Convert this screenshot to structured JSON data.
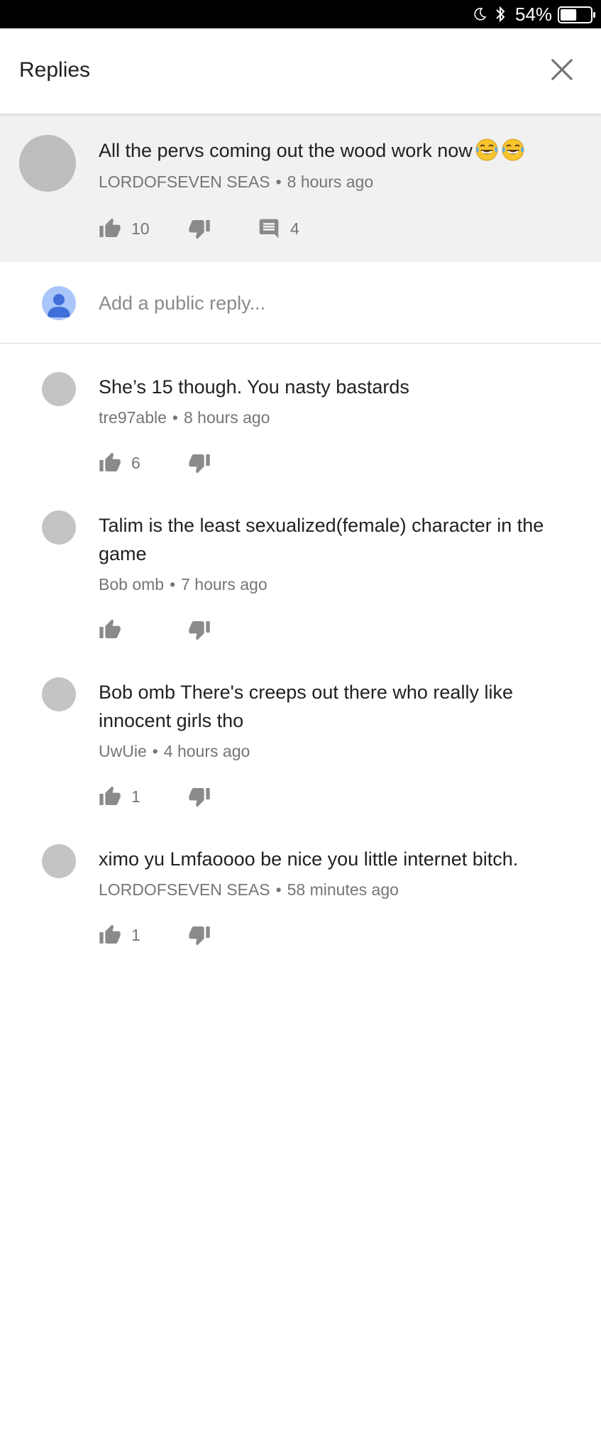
{
  "status_bar": {
    "battery_percent": "54%",
    "battery_level": 0.54
  },
  "header": {
    "title": "Replies"
  },
  "parent_comment": {
    "text": "All the pervs coming out the wood work now",
    "author": "LORDOFSEVEN SEAS",
    "time": "8 hours ago",
    "likes": "10",
    "replies": "4",
    "emojis": [
      "face-with-tears-of-joy-icon",
      "face-with-tears-of-joy-icon"
    ]
  },
  "composer": {
    "placeholder": "Add a public reply..."
  },
  "replies": [
    {
      "text": "She’s 15 though. You nasty bastards",
      "author": "tre97able",
      "time": "8 hours ago",
      "likes": "6"
    },
    {
      "text": "Talim is the least sexualized(female) character in the game",
      "author": "Bob omb",
      "time": "7 hours ago",
      "likes": ""
    },
    {
      "text": "Bob omb There's creeps out there who really like innocent girls tho",
      "author": "UwUie",
      "time": "4 hours ago",
      "likes": "1"
    },
    {
      "text": "ximo yu Lmfaoooo be nice you little internet bitch.",
      "author": "LORDOFSEVEN SEAS",
      "time": "58 minutes ago",
      "likes": "1"
    }
  ],
  "colors": {
    "secondary_text": "#757575",
    "icon_grey": "#8a8a8a",
    "parent_bg": "#f1f1f1",
    "self_avatar": "#a9c5fa",
    "self_avatar_fg": "#3f6fd8"
  }
}
